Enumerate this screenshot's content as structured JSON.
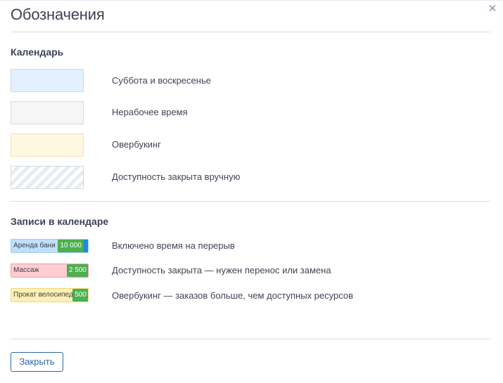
{
  "modal": {
    "title": "Обозначения",
    "close_icon": "close-icon"
  },
  "calendar": {
    "title": "Календарь",
    "items": [
      {
        "label": "Суббота и воскресенье",
        "color": "#e3f0fd"
      },
      {
        "label": "Нерабочее время",
        "color": "#f6f6f6"
      },
      {
        "label": "Овербукинг",
        "color": "#fff8e1"
      },
      {
        "label": "Доступность закрыта вручную",
        "pattern": "diagonal-stripes"
      }
    ]
  },
  "bookings": {
    "title": "Записи в календаре",
    "items": [
      {
        "name": "Аренда бани",
        "price": "10 000",
        "label": "Включено время на перерыв",
        "color": "#bfe0fb",
        "accent": "#1e88e5"
      },
      {
        "name": "Массаж",
        "price": "2 500",
        "label": "Доступность закрыта — нужен перенос или замена",
        "color": "#ffcdd2"
      },
      {
        "name": "Прокат велосипеда",
        "price": "500",
        "label": "Овербукинг — заказов больше, чем доступных ресурсов",
        "color": "#fff0b3"
      }
    ]
  },
  "footer": {
    "close_label": "Закрыть"
  }
}
